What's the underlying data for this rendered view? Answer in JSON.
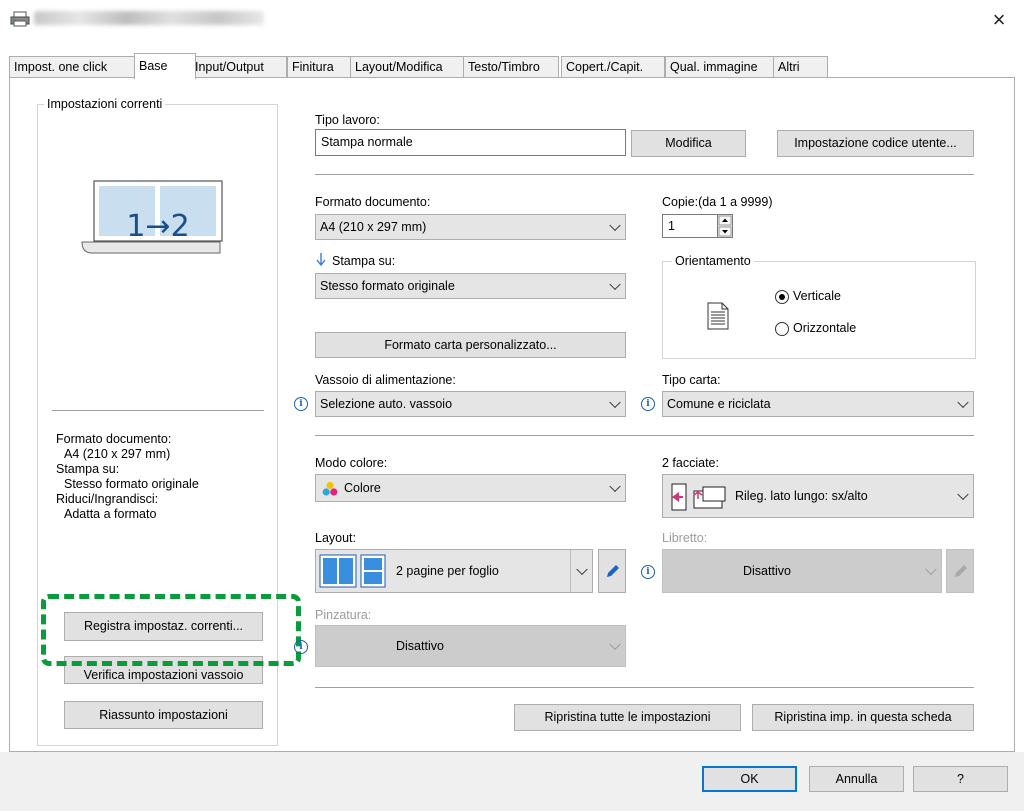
{
  "window": {
    "close_symbol": "×"
  },
  "tabs": [
    {
      "label": "Impost. one click"
    },
    {
      "label": "Base"
    },
    {
      "label": "Input/Output"
    },
    {
      "label": "Finitura"
    },
    {
      "label": "Layout/Modifica"
    },
    {
      "label": "Testo/Timbro"
    },
    {
      "label": "Copert./Capit."
    },
    {
      "label": "Qual. immagine"
    },
    {
      "label": "Altri"
    }
  ],
  "left": {
    "group_title": "Impostazioni correnti",
    "preview_text": "1→2",
    "summary": [
      "Formato documento:",
      "A4 (210 x 297 mm)",
      "Stampa su:",
      "Stesso formato originale",
      "Riduci/Ingrandisci:",
      "Adatta a formato"
    ],
    "register_button": "Registra impostaz. correnti...",
    "verify_button": "Verifica impostazioni vassoio",
    "summary_button": "Riassunto impostazioni"
  },
  "job": {
    "label": "Tipo lavoro:",
    "value": "Stampa normale",
    "modify_button": "Modifica",
    "user_code_button": "Impostazione codice utente..."
  },
  "doc_format": {
    "label": "Formato documento:",
    "value": "A4 (210 x 297 mm)"
  },
  "copies": {
    "label": "Copie:(da 1 a 9999)",
    "value": "1"
  },
  "print_on": {
    "label": "Stampa su:",
    "value": "Stesso formato originale"
  },
  "custom_size_button": "Formato carta personalizzato...",
  "orientation": {
    "title": "Orientamento",
    "portrait": "Verticale",
    "landscape": "Orizzontale",
    "selected": "Verticale"
  },
  "tray": {
    "label": "Vassoio di alimentazione:",
    "value": "Selezione auto. vassoio"
  },
  "paper_type": {
    "label": "Tipo carta:",
    "value": "Comune e riciclata"
  },
  "color_mode": {
    "label": "Modo colore:",
    "value": "Colore"
  },
  "duplex": {
    "label": "2 facciate:",
    "value": "Rileg. lato lungo: sx/alto"
  },
  "layout": {
    "label": "Layout:",
    "value": "2 pagine per foglio"
  },
  "booklet": {
    "label": "Libretto:",
    "value": "Disattivo"
  },
  "staple": {
    "label": "Pinzatura:",
    "value": "Disattivo"
  },
  "restore_all_button": "Ripristina tutte le impostazioni",
  "restore_tab_button": "Ripristina imp. in questa scheda",
  "footer": {
    "ok": "OK",
    "cancel": "Annulla",
    "help": "?"
  },
  "colors": {
    "accent": "#0078d7",
    "highlight_dashed": "#0a9b3c",
    "info_icon": "#1a5fb4"
  }
}
